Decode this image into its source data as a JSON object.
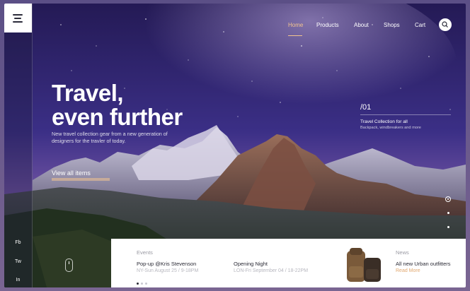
{
  "sidebar": {
    "social": [
      "Fb",
      "Tw",
      "In"
    ]
  },
  "nav": {
    "items": [
      "Home",
      "Products",
      "About",
      "Shops",
      "Cart"
    ],
    "active": "Home"
  },
  "hero": {
    "title_line1": "Travel,",
    "title_line2": "even further",
    "subtitle_line1": "New travel collection gear from a new generation of",
    "subtitle_line2": "designers for the travler of today.",
    "cta": "View all items"
  },
  "slide": {
    "number": "/01",
    "title": "Travel Collection for all",
    "subtitle": "Backpack, windbreakers and more"
  },
  "bottom": {
    "events_label": "Events",
    "events": [
      {
        "title": "Pop-up @Kris Stevenson",
        "sub": "NY-Sun August 25 / 9-18PM"
      },
      {
        "title": "Opening Night",
        "sub": "LON-Fri September 04 / 18-22PM"
      }
    ],
    "news_label": "News",
    "news_title": "All new Urban outfitters",
    "news_link": "Read More"
  },
  "colors": {
    "accent": "#f3c48f",
    "sky_top": "#2a1c5e",
    "sky_glow": "#b06aa8"
  },
  "icons": {
    "menu": "hamburger-icon",
    "search": "search-icon",
    "scroll": "mouse-icon"
  }
}
